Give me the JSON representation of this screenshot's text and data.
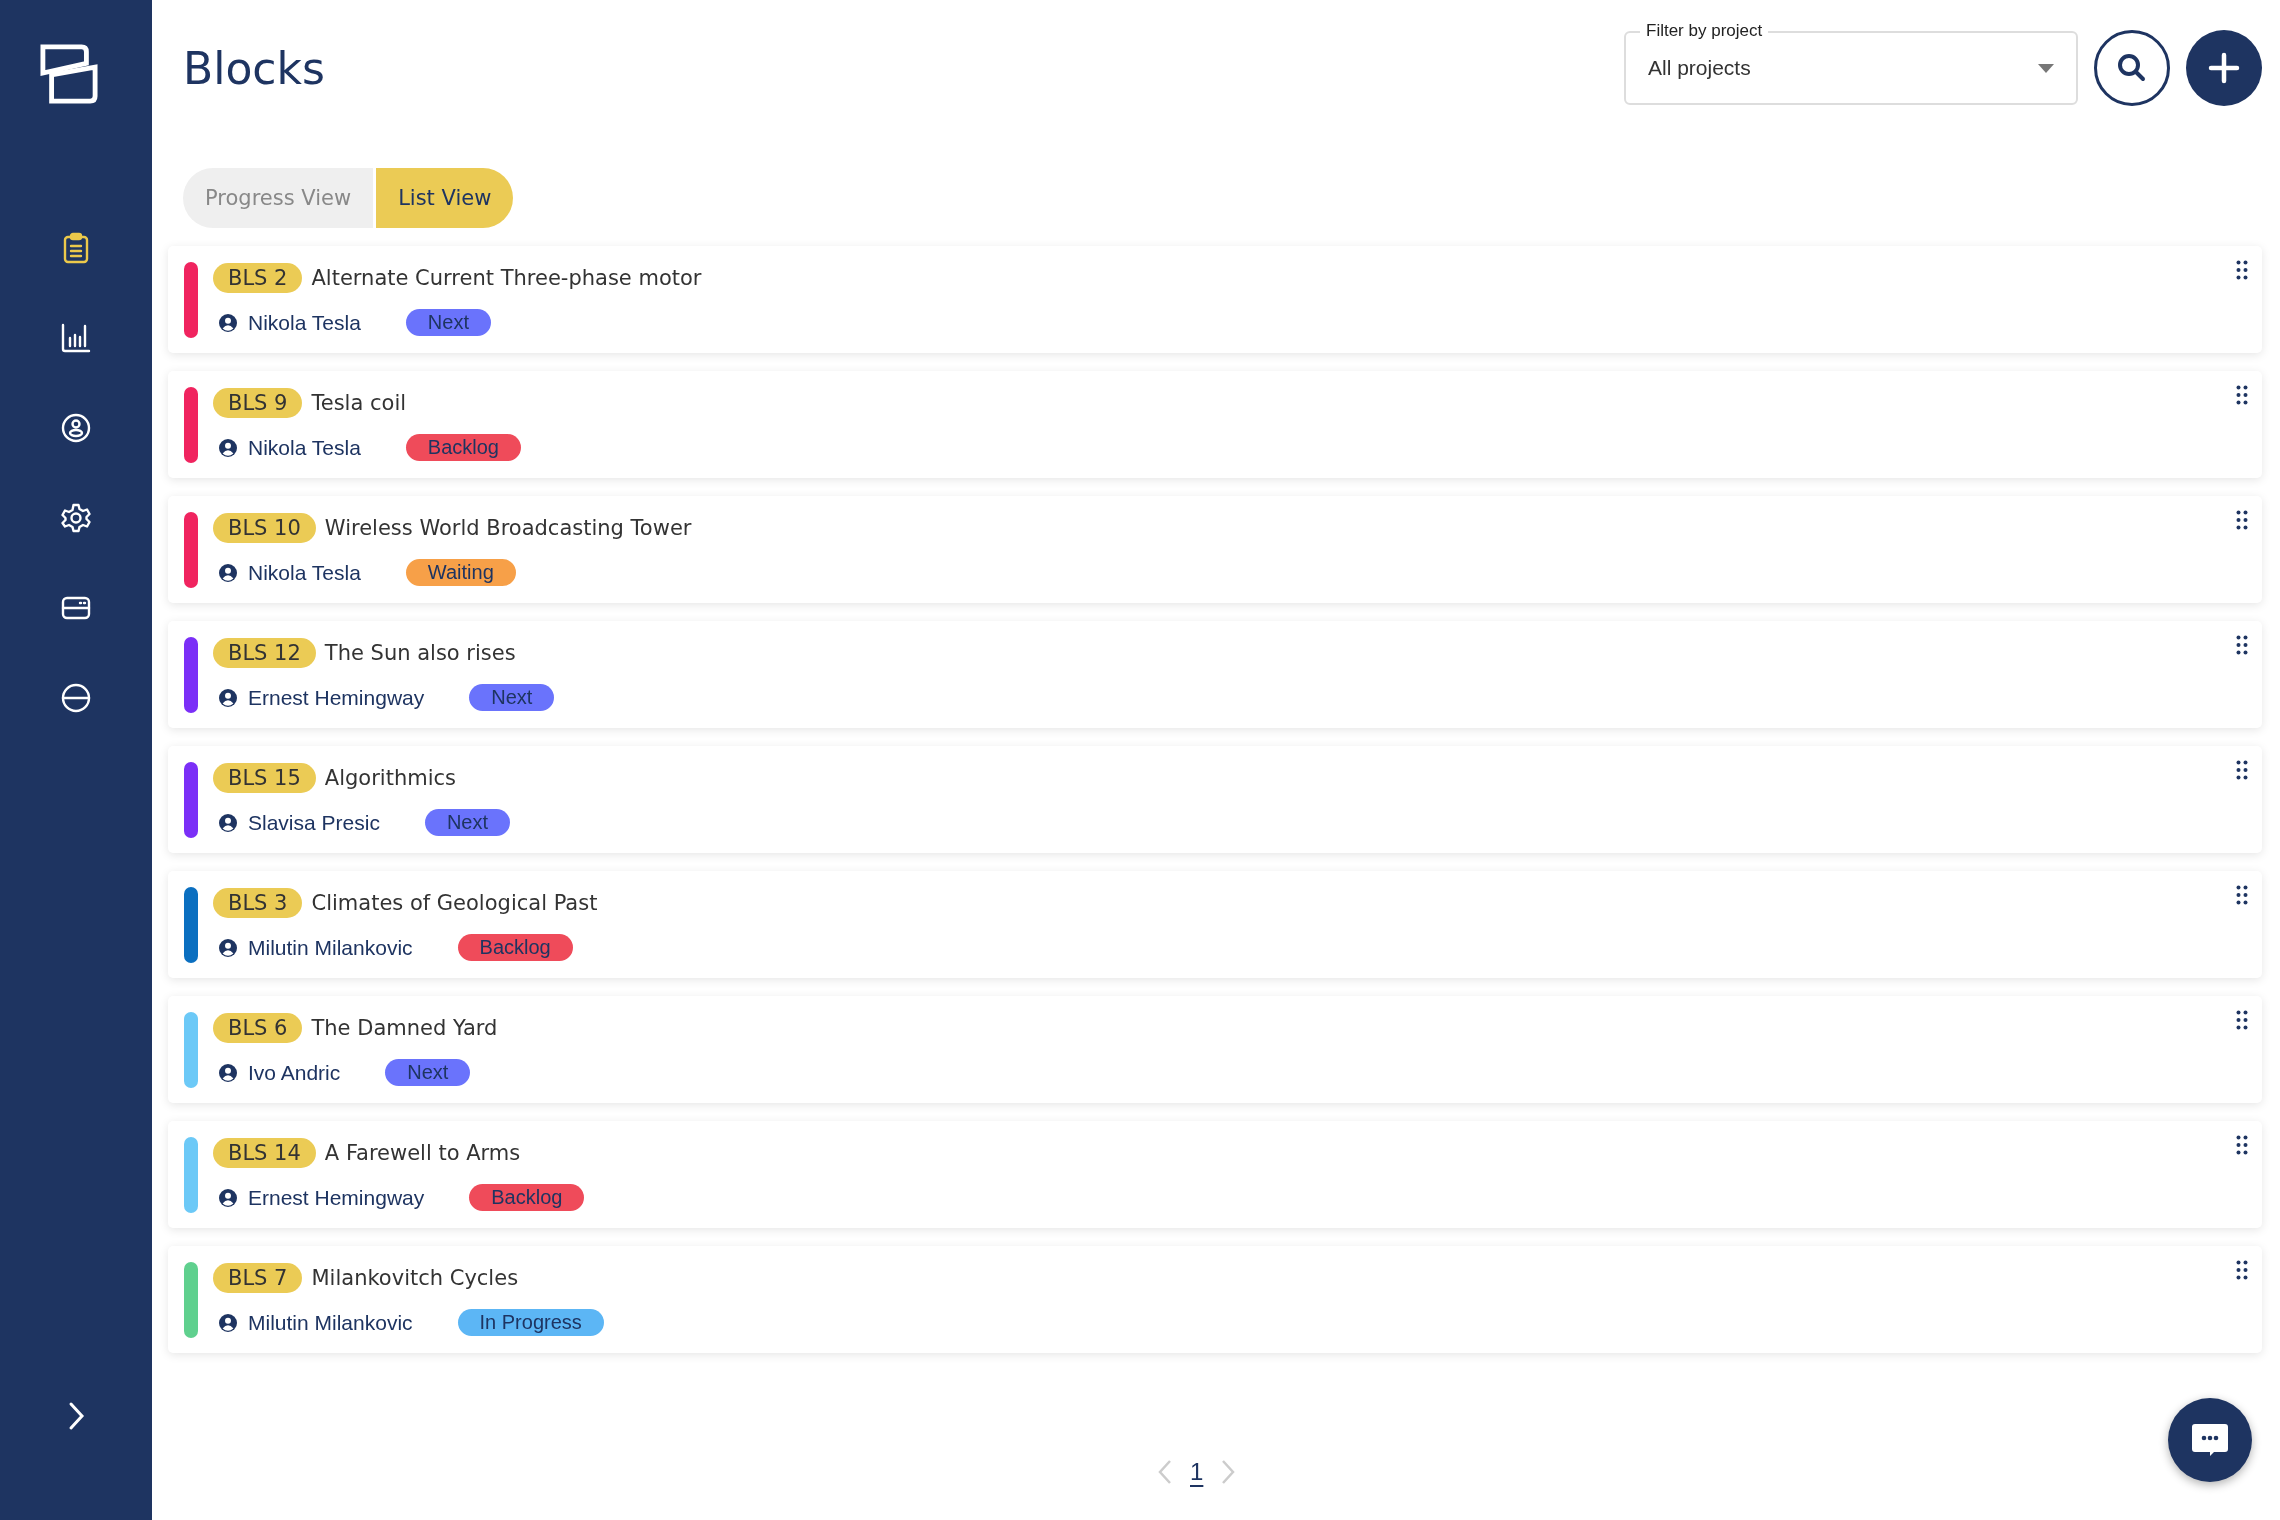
{
  "sidebar": {
    "items": [
      {
        "kind": "clipboard",
        "selected": true
      },
      {
        "kind": "chart",
        "selected": false
      },
      {
        "kind": "user",
        "selected": false
      },
      {
        "kind": "gear",
        "selected": false
      },
      {
        "kind": "card",
        "selected": false
      },
      {
        "kind": "circle",
        "selected": false
      }
    ]
  },
  "header": {
    "title": "Blocks",
    "filter": {
      "label": "Filter by project",
      "value": "All projects"
    }
  },
  "tabs": [
    {
      "label": "Progress View",
      "selected": false
    },
    {
      "label": "List View",
      "selected": true
    }
  ],
  "blocks": [
    {
      "code": "BLS 2",
      "title": "Alternate Current Three-phase motor",
      "owner": "Nikola Tesla",
      "status": {
        "label": "Next",
        "color": "#6a73fc"
      },
      "color": "#f0245f"
    },
    {
      "code": "BLS 9",
      "title": "Tesla coil",
      "owner": "Nikola Tesla",
      "status": {
        "label": "Backlog",
        "color": "#ef4b5a"
      },
      "color": "#f0245f"
    },
    {
      "code": "BLS 10",
      "title": "Wireless World Broadcasting Tower",
      "owner": "Nikola Tesla",
      "status": {
        "label": "Waiting",
        "color": "#f7a048"
      },
      "color": "#f0245f"
    },
    {
      "code": "BLS 12",
      "title": "The Sun also rises",
      "owner": "Ernest Hemingway",
      "status": {
        "label": "Next",
        "color": "#6a73fc"
      },
      "color": "#7b2ff7"
    },
    {
      "code": "BLS 15",
      "title": "Algorithmics",
      "owner": "Slavisa Presic",
      "status": {
        "label": "Next",
        "color": "#6a73fc"
      },
      "color": "#7b2ff7"
    },
    {
      "code": "BLS 3",
      "title": "Climates of Geological Past",
      "owner": "Milutin Milankovic",
      "status": {
        "label": "Backlog",
        "color": "#ef4b5a"
      },
      "color": "#0b6fc0"
    },
    {
      "code": "BLS 6",
      "title": "The Damned Yard",
      "owner": "Ivo Andric",
      "status": {
        "label": "Next",
        "color": "#6a73fc"
      },
      "color": "#6cc9f7"
    },
    {
      "code": "BLS 14",
      "title": "A Farewell to Arms",
      "owner": "Ernest Hemingway",
      "status": {
        "label": "Backlog",
        "color": "#ef4b5a"
      },
      "color": "#6cc9f7"
    },
    {
      "code": "BLS 7",
      "title": "Milankovitch Cycles",
      "owner": "Milutin Milankovic",
      "status": {
        "label": "In Progress",
        "color": "#5cb6f5"
      },
      "color": "#5fd08e"
    }
  ],
  "pagination": {
    "pages": [
      {
        "label": "1",
        "selected": true
      }
    ]
  }
}
